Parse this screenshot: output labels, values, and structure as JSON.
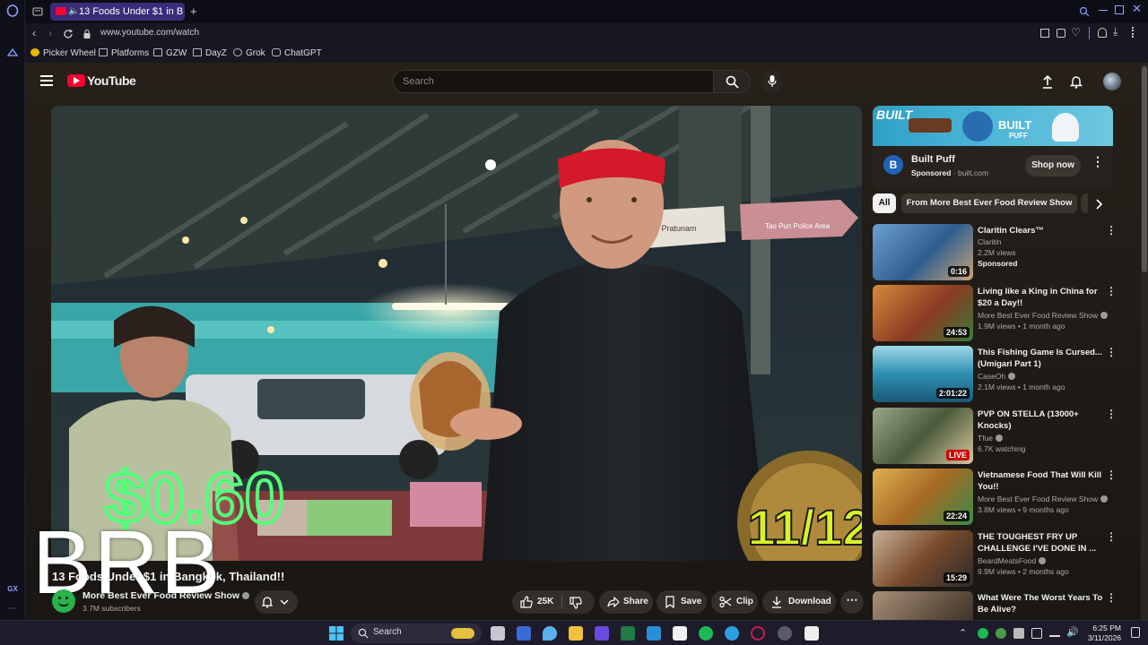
{
  "browser": {
    "tab_title": "13 Foods Under $1 in B",
    "new_tab": "+",
    "url": "www.youtube.com/watch",
    "bookmarks": [
      {
        "label": "Picker Wheel",
        "icon": "picker-wheel-icon"
      },
      {
        "label": "Platforms",
        "icon": "folder-icon"
      },
      {
        "label": "GZW",
        "icon": "folder-icon"
      },
      {
        "label": "DayZ",
        "icon": "folder-icon"
      },
      {
        "label": "Grok",
        "icon": "grok-icon"
      },
      {
        "label": "ChatGPT",
        "icon": "chatgpt-icon"
      }
    ],
    "rail_label": "GX"
  },
  "youtube": {
    "logo_text": "YouTube",
    "search_placeholder": "Search",
    "video": {
      "overlay_text": "BRB",
      "neon_text": "$0.60",
      "badge_text": "11/12",
      "sign_left_text": "Pratunam",
      "sign_right_text": "Tao Pun Police Area",
      "title": "13 Foods Under $1 in Bangkok, Thailand!!",
      "channel": "More Best Ever Food Review Show",
      "subscribers": "3.7M subscribers",
      "likes": "25K",
      "share": "Share",
      "save": "Save",
      "clip": "Clip",
      "download": "Download"
    },
    "ad": {
      "banner_text": "BUILT",
      "banner_sub": "PUFF",
      "name": "Built Puff",
      "sponsored": "Sponsored",
      "domain": "built.com",
      "cta": "Shop now"
    },
    "chips": [
      "All",
      "From More Best Ever Food Review Show"
    ],
    "recommendations": [
      {
        "title": "Claritin Clears™",
        "channel": "Claritin",
        "meta": "2.2M views",
        "extra": "Sponsored",
        "duration": "0:16",
        "verified": false,
        "thumb_color": "#3c6da0"
      },
      {
        "title": "Living like a King in China for $20 a Day!!",
        "channel": "More Best Ever Food Review Show",
        "meta": "1.9M views • 1 month ago",
        "duration": "24:53",
        "verified": true,
        "thumb_color": "#b06a34"
      },
      {
        "title": "This Fishing Game Is Cursed... (Umigari Part 1)",
        "channel": "CaseOh",
        "meta": "2.1M views • 1 month ago",
        "duration": "2:01:22",
        "verified": true,
        "thumb_color": "#2a7e9a"
      },
      {
        "title": "PVP ON STELLA (13000+ Knocks)",
        "channel": "Tfue",
        "meta": "6.7K watching",
        "duration": "LIVE",
        "verified": true,
        "thumb_color": "#6f7a60"
      },
      {
        "title": "Vietnamese Food That Will Kill You!!",
        "channel": "More Best Ever Food Review Show",
        "meta": "3.8M views • 9 months ago",
        "duration": "22:24",
        "verified": true,
        "thumb_color": "#9a7a2a"
      },
      {
        "title": "THE TOUGHEST FRY UP CHALLENGE I'VE DONE IN ...",
        "channel": "BeardMeatsFood",
        "meta": "9.9M views • 2 months ago",
        "duration": "15:29",
        "verified": true,
        "thumb_color": "#7a5030"
      },
      {
        "title": "What Were The Worst Years To Be Alive?",
        "channel": "",
        "meta": "",
        "duration": "",
        "verified": false,
        "thumb_color": "#5a4a3a"
      }
    ]
  },
  "taskbar": {
    "search_placeholder": "Search",
    "time": "6:25 PM",
    "date": "3/11/2026"
  },
  "colors": {
    "youtube_red": "#ff0033",
    "tab_active": "#3a2c78",
    "taskbar": "#1e1c2a"
  }
}
